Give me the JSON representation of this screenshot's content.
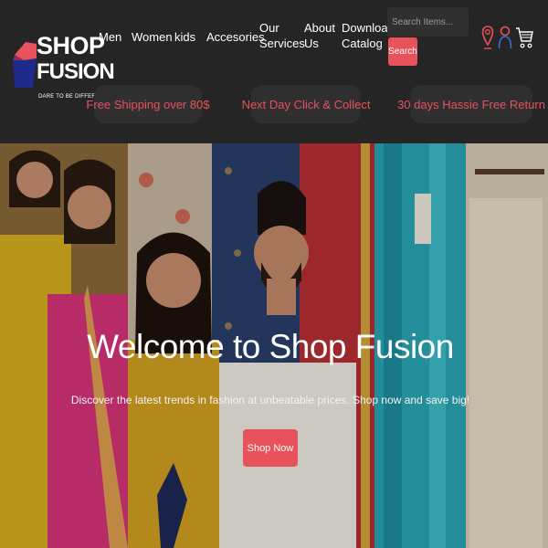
{
  "brand": {
    "name_line1": "SHOP",
    "name_line2": "FUSION",
    "tagline": "DARE TO BE DIFFERENT"
  },
  "nav": {
    "items": [
      {
        "label": "Men"
      },
      {
        "label": "Women"
      },
      {
        "label": "kids"
      },
      {
        "label": "Accesories"
      },
      {
        "label": "Our Services"
      },
      {
        "label": "About Us"
      },
      {
        "label": "Download Catalog"
      }
    ]
  },
  "search": {
    "placeholder": "Search Items...",
    "button_label": "Search"
  },
  "header_icons": [
    "location-pin-icon",
    "user-icon",
    "shopping-cart-icon"
  ],
  "promos": [
    {
      "label": "Free Shipping over 80$"
    },
    {
      "label": "Next Day Click & Collect"
    },
    {
      "label": "30 days Hassie Free Return"
    }
  ],
  "hero": {
    "title": "Welcome to Shop Fusion",
    "subtitle": "Discover the latest trends in fashion at unbeatable prices. Shop now and save big!",
    "cta_label": "Shop Now"
  },
  "colors": {
    "header_bg": "#252525",
    "promo_bg": "#2f2f2f",
    "accent": "#e8525a",
    "brand_blue": "#1f2a8a",
    "text": "#ffffff"
  }
}
